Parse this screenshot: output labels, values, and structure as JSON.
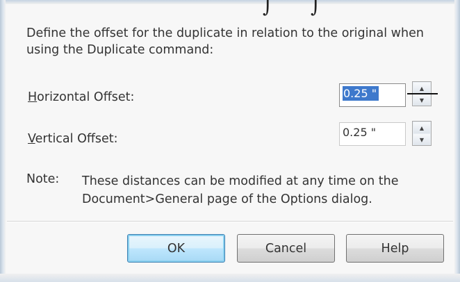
{
  "dialog": {
    "description": "Define the offset for the duplicate in relation to the original when using the Duplicate command:",
    "horizontal": {
      "label_accel": "H",
      "label_rest": "orizontal Offset:",
      "value": "0.25 \""
    },
    "vertical": {
      "label_accel": "V",
      "label_rest": "ertical Offset:",
      "value": "0.25 \""
    },
    "note": {
      "label": "Note:",
      "text": "These distances can be modified at any time on the Document>General page of the Options dialog."
    },
    "buttons": {
      "ok": "OK",
      "cancel": "Cancel",
      "help": "Help"
    }
  },
  "icons": {
    "spin_up": "▲",
    "spin_down": "▼"
  },
  "colors": {
    "selection": "#3e79cc",
    "default_button": "#bee6fd"
  }
}
